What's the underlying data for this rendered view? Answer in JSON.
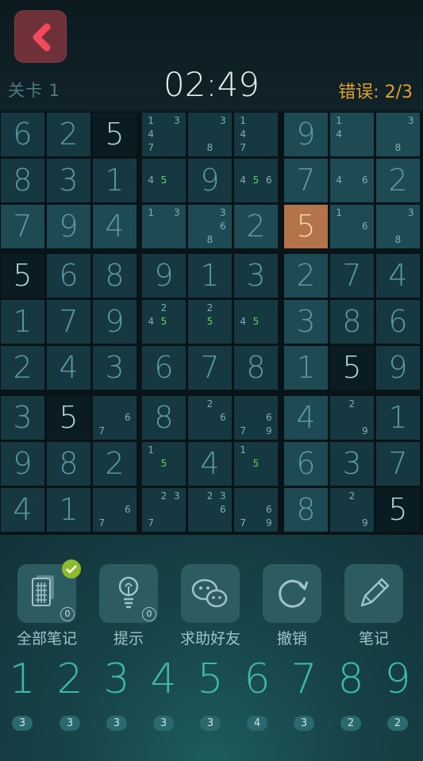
{
  "header": {
    "level_label": "关卡 1",
    "timer": "02:49",
    "errors_label": "错误: ",
    "errors_value": "2/3"
  },
  "board": {
    "selected": [
      2,
      6
    ],
    "cells": [
      [
        {
          "v": "6"
        },
        {
          "v": "2"
        },
        {
          "v": "5",
          "given": true
        },
        {
          "n": [
            "1",
            "",
            "3",
            "4",
            "",
            "",
            "7",
            "",
            ""
          ]
        },
        {
          "n": [
            "",
            "",
            "3",
            "",
            "",
            "",
            "",
            "8",
            ""
          ]
        },
        {
          "n": [
            "1",
            "",
            "",
            "4",
            "",
            "",
            "7",
            "",
            ""
          ]
        },
        {
          "v": "9"
        },
        {
          "n": [
            "1",
            "",
            "",
            "4",
            "",
            "",
            "",
            "",
            ""
          ]
        },
        {
          "n": [
            "",
            "",
            "3",
            "",
            "",
            "",
            "",
            "8",
            ""
          ]
        }
      ],
      [
        {
          "v": "8"
        },
        {
          "v": "3"
        },
        {
          "v": "1"
        },
        {
          "n": [
            "",
            "",
            "",
            "4",
            "5g",
            "",
            "",
            "",
            ""
          ]
        },
        {
          "v": "9"
        },
        {
          "n": [
            "",
            "",
            "",
            "4",
            "5g",
            "6",
            "",
            "",
            ""
          ]
        },
        {
          "v": "7"
        },
        {
          "n": [
            "",
            "",
            "",
            "4",
            "",
            "6",
            "",
            "",
            ""
          ]
        },
        {
          "v": "2"
        }
      ],
      [
        {
          "v": "7"
        },
        {
          "v": "9"
        },
        {
          "v": "4"
        },
        {
          "n": [
            "1",
            "",
            "3",
            "",
            "",
            "",
            "",
            "",
            ""
          ]
        },
        {
          "n": [
            "",
            "",
            "3",
            "",
            "",
            "6",
            "",
            "8",
            ""
          ]
        },
        {
          "v": "2"
        },
        {
          "v": "5",
          "sel": true
        },
        {
          "n": [
            "1",
            "",
            "",
            "",
            "",
            "6",
            "",
            "",
            ""
          ]
        },
        {
          "n": [
            "",
            "",
            "3",
            "",
            "",
            "",
            "",
            "8",
            ""
          ]
        }
      ],
      [
        {
          "v": "5",
          "given": true
        },
        {
          "v": "6"
        },
        {
          "v": "8"
        },
        {
          "v": "9"
        },
        {
          "v": "1"
        },
        {
          "v": "3"
        },
        {
          "v": "2"
        },
        {
          "v": "7"
        },
        {
          "v": "4"
        }
      ],
      [
        {
          "v": "1"
        },
        {
          "v": "7"
        },
        {
          "v": "9"
        },
        {
          "n": [
            "",
            "2",
            "",
            "4",
            "5g",
            "",
            "",
            "",
            ""
          ]
        },
        {
          "n": [
            "",
            "2",
            "",
            "",
            "5g",
            "",
            "",
            "",
            ""
          ]
        },
        {
          "n": [
            "",
            "",
            "",
            "4",
            "5g",
            "",
            "",
            "",
            ""
          ]
        },
        {
          "v": "3"
        },
        {
          "v": "8"
        },
        {
          "v": "6"
        }
      ],
      [
        {
          "v": "2"
        },
        {
          "v": "4"
        },
        {
          "v": "3"
        },
        {
          "v": "6"
        },
        {
          "v": "7"
        },
        {
          "v": "8"
        },
        {
          "v": "1"
        },
        {
          "v": "5",
          "given": true
        },
        {
          "v": "9"
        }
      ],
      [
        {
          "v": "3"
        },
        {
          "v": "5",
          "given": true
        },
        {
          "n": [
            "",
            "",
            "",
            "",
            "",
            "6",
            "7",
            "",
            ""
          ]
        },
        {
          "v": "8"
        },
        {
          "n": [
            "",
            "2",
            "",
            "",
            "",
            "6",
            "",
            "",
            ""
          ]
        },
        {
          "n": [
            "",
            "",
            "",
            "",
            "",
            "6",
            "7",
            "",
            "9"
          ]
        },
        {
          "v": "4"
        },
        {
          "n": [
            "",
            "2",
            "",
            "",
            "",
            "",
            "",
            "",
            "9"
          ]
        },
        {
          "v": "1"
        }
      ],
      [
        {
          "v": "9"
        },
        {
          "v": "8"
        },
        {
          "v": "2"
        },
        {
          "n": [
            "1",
            "",
            "",
            "",
            "5g",
            "",
            "",
            "",
            ""
          ]
        },
        {
          "v": "4"
        },
        {
          "n": [
            "1",
            "",
            "",
            "",
            "5g",
            "",
            "",
            "",
            ""
          ]
        },
        {
          "v": "6"
        },
        {
          "v": "3"
        },
        {
          "v": "7"
        }
      ],
      [
        {
          "v": "4"
        },
        {
          "v": "1"
        },
        {
          "n": [
            "",
            "",
            "",
            "",
            "",
            "6",
            "7",
            "",
            ""
          ]
        },
        {
          "n": [
            "",
            "2",
            "3",
            "",
            "",
            "",
            "7",
            "",
            ""
          ]
        },
        {
          "n": [
            "",
            "2",
            "3",
            "",
            "",
            "6",
            "",
            "",
            ""
          ]
        },
        {
          "n": [
            "",
            "",
            "",
            "",
            "",
            "6",
            "7",
            "",
            "9"
          ]
        },
        {
          "v": "8"
        },
        {
          "n": [
            "",
            "2",
            "",
            "",
            "",
            "",
            "",
            "",
            "9"
          ]
        },
        {
          "v": "5",
          "given": true
        }
      ]
    ]
  },
  "tools": [
    {
      "label": "全部笔记",
      "icon": "all-notes-icon",
      "badge": "0",
      "checked": true
    },
    {
      "label": "提示",
      "icon": "lightbulb-icon",
      "badge": "0",
      "checked": false
    },
    {
      "label": "求助好友",
      "icon": "wechat-icon",
      "badge": "",
      "checked": false
    },
    {
      "label": "撤销",
      "icon": "undo-icon",
      "badge": "",
      "checked": false
    },
    {
      "label": "笔记",
      "icon": "pencil-icon",
      "badge": "",
      "checked": false
    }
  ],
  "numpad": [
    {
      "digit": "1",
      "remaining": "3"
    },
    {
      "digit": "2",
      "remaining": "3"
    },
    {
      "digit": "3",
      "remaining": "3"
    },
    {
      "digit": "4",
      "remaining": "3"
    },
    {
      "digit": "5",
      "remaining": "3"
    },
    {
      "digit": "6",
      "remaining": "4"
    },
    {
      "digit": "7",
      "remaining": "3"
    },
    {
      "digit": "8",
      "remaining": "2"
    },
    {
      "digit": "9",
      "remaining": "2"
    }
  ],
  "colors": {
    "accent": "#3fb8a8",
    "error": "#e3a028",
    "back_button": "#6e3139",
    "selected_cell": "#b3744b",
    "note_highlight": "#5fd16a"
  }
}
